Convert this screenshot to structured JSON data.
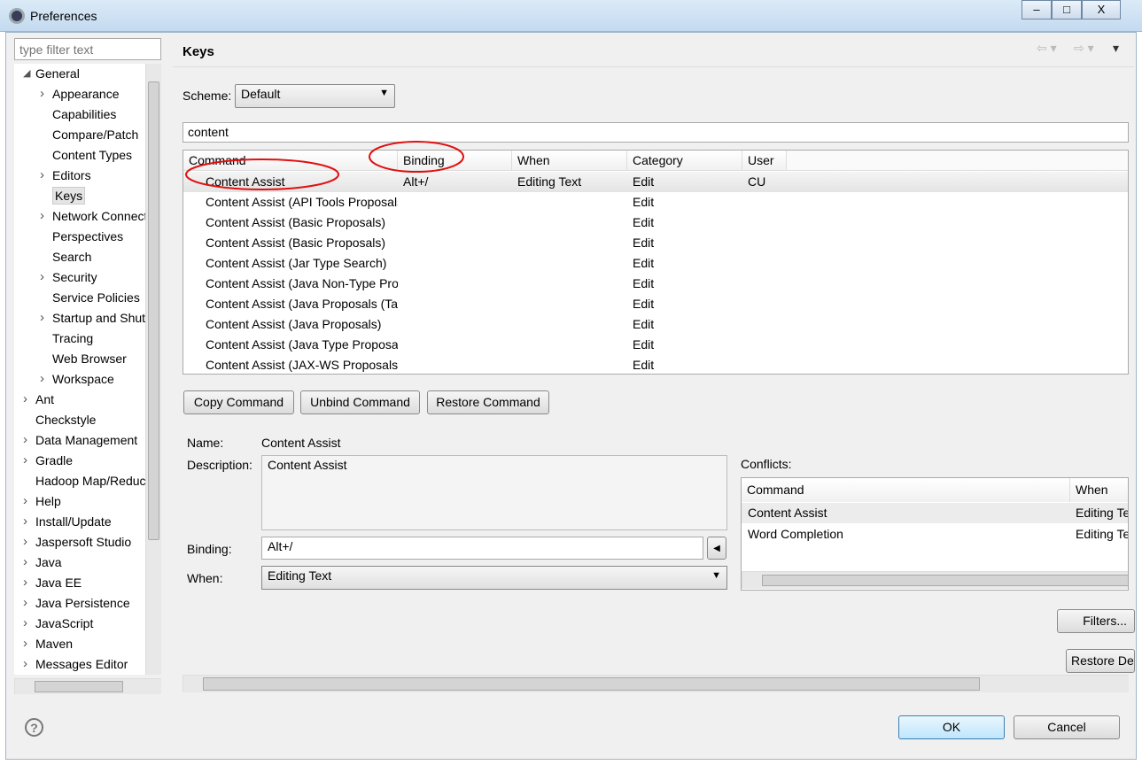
{
  "window": {
    "title": "Preferences",
    "minimize": "–",
    "maximize": "□",
    "close": "X"
  },
  "filter": {
    "placeholder": "type filter text"
  },
  "tree": [
    {
      "label": "General",
      "level": 0,
      "twisty": "expanded"
    },
    {
      "label": "Appearance",
      "level": 1,
      "twisty": "collapsed"
    },
    {
      "label": "Capabilities",
      "level": 1
    },
    {
      "label": "Compare/Patch",
      "level": 1
    },
    {
      "label": "Content Types",
      "level": 1
    },
    {
      "label": "Editors",
      "level": 1,
      "twisty": "collapsed"
    },
    {
      "label": "Keys",
      "level": 1,
      "selected": true
    },
    {
      "label": "Network Connections",
      "level": 1,
      "twisty": "collapsed"
    },
    {
      "label": "Perspectives",
      "level": 1
    },
    {
      "label": "Search",
      "level": 1
    },
    {
      "label": "Security",
      "level": 1,
      "twisty": "collapsed"
    },
    {
      "label": "Service Policies",
      "level": 1
    },
    {
      "label": "Startup and Shutdown",
      "level": 1,
      "twisty": "collapsed"
    },
    {
      "label": "Tracing",
      "level": 1
    },
    {
      "label": "Web Browser",
      "level": 1
    },
    {
      "label": "Workspace",
      "level": 1,
      "twisty": "collapsed"
    },
    {
      "label": "Ant",
      "level": 0,
      "twisty": "collapsed"
    },
    {
      "label": "Checkstyle",
      "level": 0
    },
    {
      "label": "Data Management",
      "level": 0,
      "twisty": "collapsed"
    },
    {
      "label": "Gradle",
      "level": 0,
      "twisty": "collapsed"
    },
    {
      "label": "Hadoop Map/Reduce",
      "level": 0
    },
    {
      "label": "Help",
      "level": 0,
      "twisty": "collapsed"
    },
    {
      "label": "Install/Update",
      "level": 0,
      "twisty": "collapsed"
    },
    {
      "label": "Jaspersoft Studio",
      "level": 0,
      "twisty": "collapsed"
    },
    {
      "label": "Java",
      "level": 0,
      "twisty": "collapsed"
    },
    {
      "label": "Java EE",
      "level": 0,
      "twisty": "collapsed"
    },
    {
      "label": "Java Persistence",
      "level": 0,
      "twisty": "collapsed"
    },
    {
      "label": "JavaScript",
      "level": 0,
      "twisty": "collapsed"
    },
    {
      "label": "Maven",
      "level": 0,
      "twisty": "collapsed"
    },
    {
      "label": "Messages Editor",
      "level": 0,
      "twisty": "collapsed"
    }
  ],
  "page": {
    "title": "Keys",
    "scheme_label": "Scheme:",
    "scheme_value": "Default",
    "search_value": "content"
  },
  "table": {
    "columns": [
      "Command",
      "Binding",
      "When",
      "Category",
      "User"
    ],
    "rows": [
      [
        "Content Assist",
        "Alt+/",
        "Editing Text",
        "Edit",
        "CU"
      ],
      [
        "Content Assist (API Tools Proposals)",
        "",
        "",
        "Edit",
        ""
      ],
      [
        "Content Assist (Basic Proposals)",
        "",
        "",
        "Edit",
        ""
      ],
      [
        "Content Assist (Basic Proposals)",
        "",
        "",
        "Edit",
        ""
      ],
      [
        "Content Assist (Jar Type Search)",
        "",
        "",
        "Edit",
        ""
      ],
      [
        "Content Assist (Java Non-Type Proposals)",
        "",
        "",
        "Edit",
        ""
      ],
      [
        "Content Assist (Java Proposals (Task-Focused))",
        "",
        "",
        "Edit",
        ""
      ],
      [
        "Content Assist (Java Proposals)",
        "",
        "",
        "Edit",
        ""
      ],
      [
        "Content Assist (Java Type Proposals)",
        "",
        "",
        "Edit",
        ""
      ],
      [
        "Content Assist (JAX-WS Proposals)",
        "",
        "",
        "Edit",
        ""
      ]
    ]
  },
  "buttons": {
    "copy": "Copy Command",
    "unbind": "Unbind Command",
    "restore": "Restore Command",
    "filters": "Filters...",
    "restore_defaults": "Restore Defaults",
    "ok": "OK",
    "cancel": "Cancel"
  },
  "details": {
    "name_label": "Name:",
    "name_value": "Content Assist",
    "description_label": "Description:",
    "description_value": "Content Assist",
    "binding_label": "Binding:",
    "binding_value": "Alt+/",
    "when_label": "When:",
    "when_value": "Editing Text"
  },
  "conflicts": {
    "label": "Conflicts:",
    "columns": [
      "Command",
      "When"
    ],
    "rows": [
      [
        "Content Assist",
        "Editing Text"
      ],
      [
        "Word Completion",
        "Editing Text"
      ]
    ]
  },
  "annotation_color": "#e01010"
}
